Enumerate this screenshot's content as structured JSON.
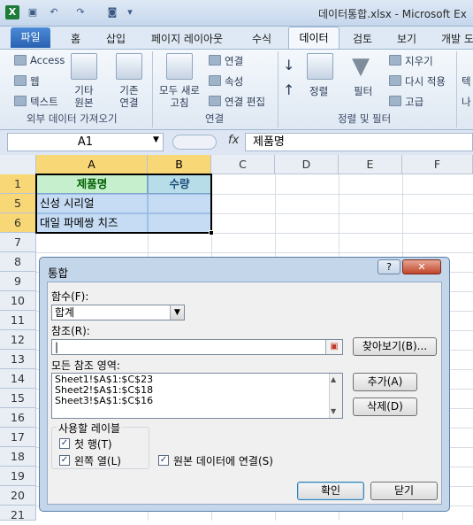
{
  "titlebar": {
    "app_icon": "X",
    "title": "데이터통합.xlsx - Microsoft Ex"
  },
  "tabs": {
    "file": "파일",
    "home": "홈",
    "insert": "삽입",
    "page_layout": "페이지 레이아웃",
    "formulas": "수식",
    "data": "데이터",
    "review": "검토",
    "view": "보기",
    "developer": "개발 도"
  },
  "ribbon": {
    "external": {
      "access": "Access",
      "web": "웹",
      "text": "텍스트",
      "other_1": "기타",
      "other_2": "원본",
      "existing_1": "기존",
      "existing_2": "연결",
      "group": "외부 데이터 가져오기"
    },
    "connections": {
      "refresh_1": "모두 새로",
      "refresh_2": "고침",
      "connections": "연결",
      "properties": "속성",
      "edit_links": "연결 편집",
      "group": "연결"
    },
    "sort_filter": {
      "sort": "정렬",
      "filter": "필터",
      "clear": "지우기",
      "reapply": "다시 적용",
      "advanced": "고급",
      "group": "정렬 및 필터"
    },
    "extra": {
      "line1": "텍",
      "line2": "나"
    }
  },
  "formula_bar": {
    "name_box": "A1",
    "fx": "fx",
    "formula": "제품명"
  },
  "columns": [
    "A",
    "B",
    "C",
    "D",
    "E",
    "F"
  ],
  "rows": [
    "1",
    "5",
    "6",
    "7",
    "8",
    "9",
    "10",
    "11",
    "12",
    "13",
    "14",
    "15",
    "16",
    "17",
    "18",
    "19",
    "20",
    "21"
  ],
  "cells": {
    "a1": "제품명",
    "b1": "수량",
    "a5": "신성 시리얼",
    "a6": "대일 파메쌍 치즈"
  },
  "dialog": {
    "title": "통합",
    "help": "?",
    "close": "✕",
    "function_label": "함수(F):",
    "function_value": "합계",
    "reference_label": "참조(R):",
    "reference_value": "|",
    "browse_button": "찾아보기(B)...",
    "all_refs_label": "모든 참조 영역:",
    "refs": [
      "Sheet1!$A$1:$C$23",
      "Sheet2!$A$1:$C$18",
      "Sheet3!$A$1:$C$16"
    ],
    "add_button": "추가(A)",
    "delete_button": "삭제(D)",
    "labels_group": "사용할 레이블",
    "top_row": "첫 행(T)",
    "left_column": "왼쪽 열(L)",
    "link_source": "원본 데이터에 연결(S)",
    "ok_button": "확인",
    "close_button": "닫기"
  },
  "colors": {
    "header_fill": "#c6efce",
    "header_text": "#006100",
    "qty_fill": "#b7dde8",
    "selection": "#c5dcf4"
  }
}
